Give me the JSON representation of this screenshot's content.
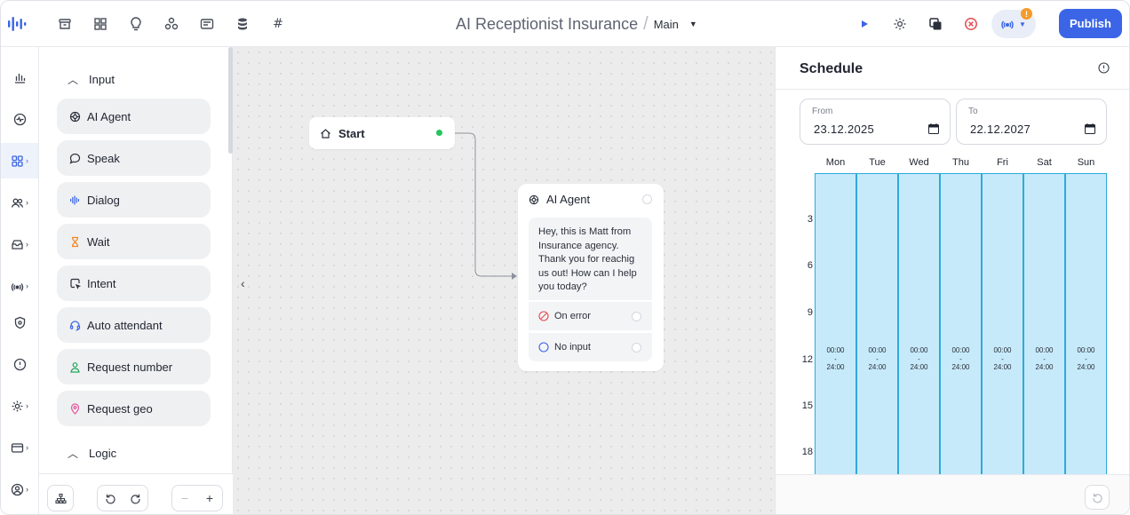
{
  "header": {
    "title": "AI Receptionist Insurance",
    "separator": "/",
    "branch": "Main",
    "publish_label": "Publish",
    "warning_badge": "!"
  },
  "rail": {
    "items": [
      "analytics-icon",
      "activity-icon",
      "apps-icon",
      "users-icon",
      "inbox-icon",
      "broadcast-icon",
      "shield-icon",
      "alert-icon",
      "settings-icon",
      "billing-icon",
      "profile-icon"
    ]
  },
  "palette": {
    "input_section": "Input",
    "logic_section": "Logic",
    "blocks": [
      {
        "label": "AI Agent",
        "icon": "agent-icon"
      },
      {
        "label": "Speak",
        "icon": "speech-bubble-icon"
      },
      {
        "label": "Dialog",
        "icon": "waveform-icon"
      },
      {
        "label": "Wait",
        "icon": "hourglass-icon"
      },
      {
        "label": "Intent",
        "icon": "intent-icon"
      },
      {
        "label": "Auto attendant",
        "icon": "headset-icon"
      },
      {
        "label": "Request number",
        "icon": "person-icon"
      },
      {
        "label": "Request geo",
        "icon": "location-pin-icon"
      }
    ]
  },
  "canvas": {
    "start_node": {
      "label": "Start"
    },
    "agent_node": {
      "title": "AI Agent",
      "message": "Hey, this is Matt from Insurance agency. Thank you for reachig us out! How can I help you today?",
      "outputs": [
        {
          "label": "On error",
          "icon": "error-icon"
        },
        {
          "label": "No input",
          "icon": "circle-icon"
        }
      ]
    }
  },
  "schedule": {
    "title": "Schedule",
    "from_label": "From",
    "from_value": "23.12.2025",
    "to_label": "To",
    "to_value": "22.12.2027",
    "days": [
      "Mon",
      "Tue",
      "Wed",
      "Thu",
      "Fri",
      "Sat",
      "Sun"
    ],
    "hours": [
      "3",
      "6",
      "9",
      "12",
      "15",
      "18"
    ],
    "slot": {
      "start": "00:00",
      "dash": "-",
      "end": "24:00"
    }
  },
  "colors": {
    "primary": "#3b65e6",
    "slot_fill": "#c7eafa",
    "slot_border": "#2eaadc",
    "status_ok": "#22c55e",
    "warning": "#f59b2b",
    "error": "#e5484d"
  }
}
